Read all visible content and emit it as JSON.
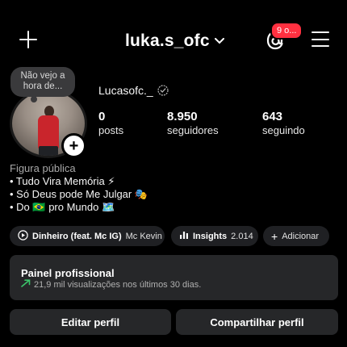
{
  "header": {
    "username": "luka.s_ofc",
    "notification_badge": "9 o...",
    "colors": {
      "badge": "#ff3040",
      "background": "#000000"
    }
  },
  "profile": {
    "note": "Não vejo a hora de...",
    "full_name": "Lucasofc._",
    "stats": [
      {
        "value": "0",
        "label": "posts"
      },
      {
        "value": "8.950",
        "label": "seguidores"
      },
      {
        "value": "643",
        "label": "seguindo"
      }
    ],
    "category": "Figura pública",
    "bio": [
      "• Tudo Vira Memória ⚡",
      "• Só Deus pode Me Julgar 🎭",
      "• Do 🇧🇷 pro Mundo 🗺️"
    ]
  },
  "chips": {
    "music_title": "Dinheiro (feat. Mc IG)",
    "music_artist": "Mc Kevin",
    "insights_label": "Insights",
    "insights_value": "2.014",
    "add_label": "Adicionar"
  },
  "pro_panel": {
    "title": "Painel profissional",
    "subtitle": "21,9 mil visualizações nos últimos 30 dias.",
    "trend_color": "#3bc46a"
  },
  "actions": {
    "edit": "Editar perfil",
    "share": "Compartilhar perfil"
  },
  "icons": [
    "plus-icon",
    "chevron-down-icon",
    "threads-icon",
    "menu-icon",
    "threads-at-icon",
    "play-icon",
    "bar-chart-icon",
    "trend-up-icon"
  ]
}
